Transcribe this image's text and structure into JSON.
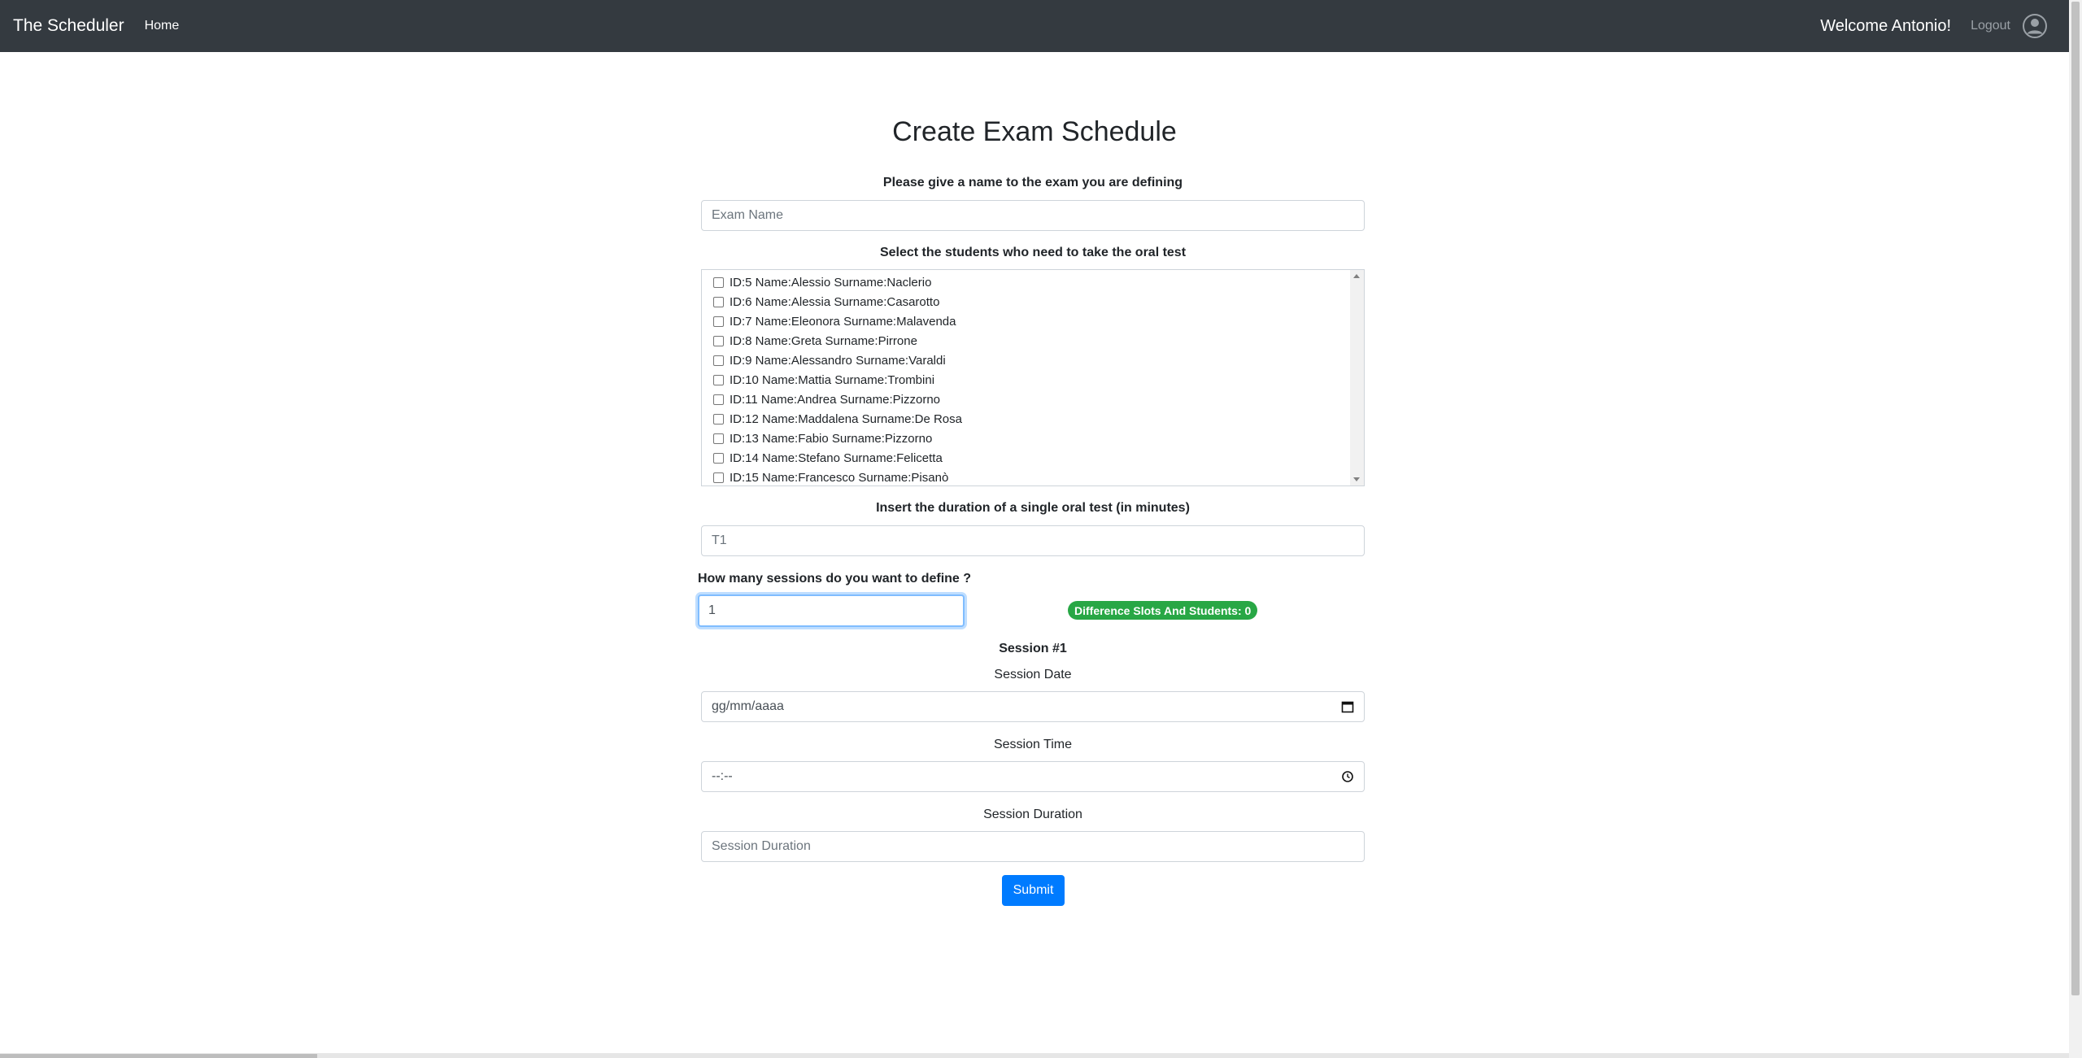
{
  "navbar": {
    "brand": "The Scheduler",
    "home": "Home",
    "welcome": "Welcome Antonio!",
    "logout": "Logout"
  },
  "page": {
    "title": "Create Exam Schedule"
  },
  "exam_name": {
    "label": "Please give a name to the exam you are defining",
    "placeholder": "Exam Name"
  },
  "students": {
    "label": "Select the students who need to take the oral test",
    "items": [
      "ID:5 Name:Alessio Surname:Naclerio",
      "ID:6 Name:Alessia Surname:Casarotto",
      "ID:7 Name:Eleonora Surname:Malavenda",
      "ID:8 Name:Greta Surname:Pirrone",
      "ID:9 Name:Alessandro Surname:Varaldi",
      "ID:10 Name:Mattia Surname:Trombini",
      "ID:11 Name:Andrea Surname:Pizzorno",
      "ID:12 Name:Maddalena Surname:De Rosa",
      "ID:13 Name:Fabio Surname:Pizzorno",
      "ID:14 Name:Stefano Surname:Felicetta",
      "ID:15 Name:Francesco Surname:Pisanò"
    ]
  },
  "duration": {
    "label": "Insert the duration of a single oral test (in minutes)",
    "placeholder": "T1"
  },
  "sessions": {
    "label": "How many sessions do you want to define ?",
    "value": "1",
    "badge": "Difference Slots And Students: 0"
  },
  "session1": {
    "title": "Session #1",
    "date_label": "Session Date",
    "date_placeholder": "gg/mm/aaaa",
    "time_label": "Session Time",
    "time_placeholder": "--:--",
    "duration_label": "Session Duration",
    "duration_placeholder": "Session Duration"
  },
  "submit": "Submit",
  "colors": {
    "navbar": "#343a40",
    "primary": "#007bff",
    "success": "#28a745"
  },
  "icons": [
    "user-circle-icon",
    "calendar-icon",
    "clock-icon",
    "checkbox"
  ]
}
